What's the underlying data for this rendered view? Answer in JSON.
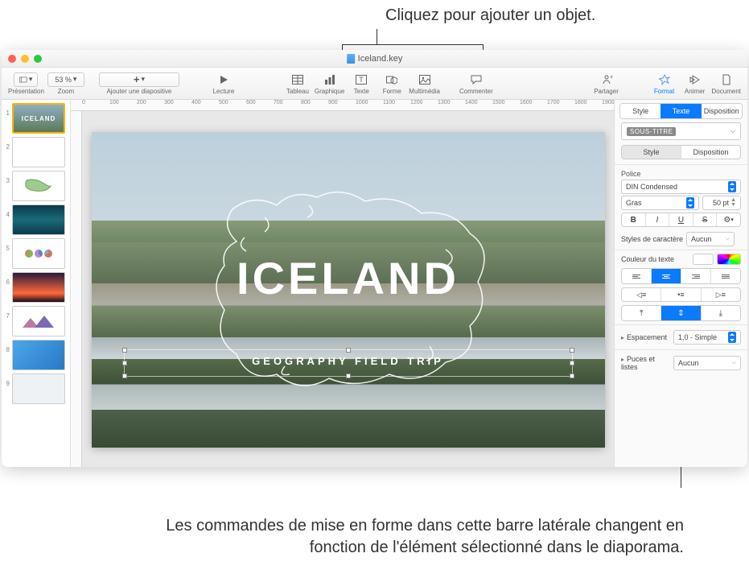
{
  "callouts": {
    "top": "Cliquez pour ajouter un objet.",
    "bottom": "Les commandes de mise en forme dans cette barre latérale changent en fonction de l'élément sélectionné dans le diaporama."
  },
  "window": {
    "title": "Iceland.key"
  },
  "toolbar": {
    "presentation": "Présentation",
    "zoom_label": "Zoom",
    "zoom_value": "53 %",
    "add_slide": "Ajouter une diapositive",
    "play": "Lecture",
    "table": "Tableau",
    "chart": "Graphique",
    "text": "Texte",
    "shape": "Forme",
    "media": "Multimédia",
    "comment": "Commenter",
    "share": "Partager",
    "format": "Format",
    "animate": "Animer",
    "document": "Document"
  },
  "ruler": [
    "0",
    "100",
    "200",
    "300",
    "400",
    "500",
    "600",
    "700",
    "800",
    "900",
    "1000",
    "1100",
    "1200",
    "1300",
    "1400",
    "1500",
    "1600",
    "1700",
    "1800",
    "1900"
  ],
  "slides": [
    1,
    2,
    3,
    4,
    5,
    6,
    7,
    8,
    9
  ],
  "main_slide": {
    "title": "ICELAND",
    "subtitle": "GEOGRAPHY FIELD TRIP"
  },
  "inspector": {
    "top_tabs": {
      "style": "Style",
      "text": "Texte",
      "arrange": "Disposition"
    },
    "paragraph_style": "SOUS-TITRE",
    "sub_tabs": {
      "style": "Style",
      "layout": "Disposition"
    },
    "font_section": "Police",
    "font_family": "DIN Condensed",
    "font_weight": "Gras",
    "font_size": "50 pt",
    "btn_bold": "B",
    "btn_italic": "I",
    "btn_underline": "U",
    "btn_strike": "S",
    "char_styles_label": "Styles de caractère",
    "char_styles_value": "Aucun",
    "text_color_label": "Couleur du texte",
    "spacing_label": "Espacement",
    "spacing_value": "1,0 - Simple",
    "bullets_label": "Puces et listes",
    "bullets_value": "Aucun"
  }
}
